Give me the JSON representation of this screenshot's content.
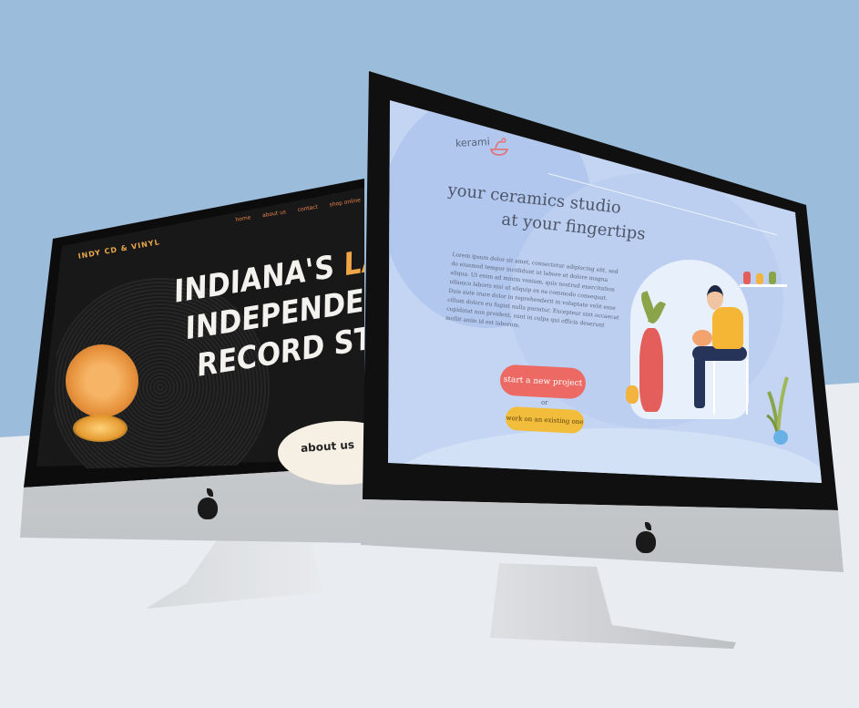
{
  "back_site": {
    "brand": "INDY CD & VINYL",
    "nav": [
      "home",
      "about us",
      "contact",
      "shop online"
    ],
    "hero_lines": [
      "INDIANA'S",
      "LARGE",
      "INDEPENDENT",
      "RECORD STOR"
    ],
    "about_button": "about us"
  },
  "front_site": {
    "brand": "kerami",
    "headline_line1": "your ceramics studio",
    "headline_line2": "at your fingertips",
    "body": "Lorem ipsum dolor sit amet, consectetur adipiscing elit, sed do eiusmod tempor incididunt ut labore et dolore magna aliqua. Ut enim ad minim veniam, quis nostrud exercitation ullamco laboris nisi ut aliquip ex ea commodo consequat. Duis aute irure dolor in reprehenderit in voluptate velit esse cillum dolore eu fugiat nulla pariatur. Excepteur sint occaecat cupidatat non proident, sunt in culpa qui officia deserunt mollit anim id est laborum.",
    "primary_button": "start a new project",
    "separator": "or",
    "secondary_button": "work on an existing one"
  },
  "colors": {
    "background": "#9cbcdc",
    "floor": "#e9edf1",
    "store_accent": "#f0a546",
    "ceramics_bg": "#c3d5f3",
    "primary_button": "#ec6a63",
    "secondary_button": "#f3bd3c"
  }
}
